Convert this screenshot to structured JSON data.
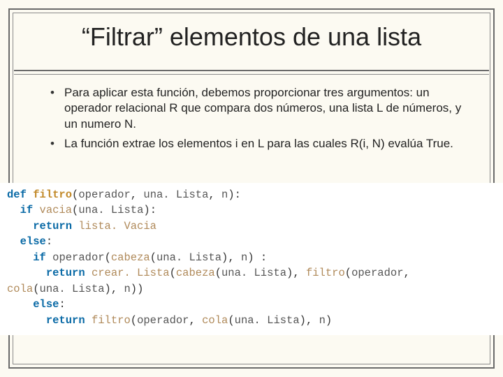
{
  "title": "“Filtrar” elementos de una lista",
  "bullets": [
    "Para aplicar esta función, debemos proporcionar tres argumentos: un operador relacional R que compara dos números, una lista L de números, y un numero N.",
    " La función extrae los elementos i en L para las cuales R(i, N) evalúa True."
  ],
  "code": {
    "kw_def": "def",
    "fn_name": "filtro",
    "arg_operador": "operador",
    "arg_lista": "una. Lista",
    "arg_n": "n",
    "kw_if": "if",
    "kw_else": "else",
    "kw_return": "return",
    "fn_vacia": "vacia",
    "id_listaVacia": "lista. Vacia",
    "fn_cabeza": "cabeza",
    "fn_crearLista": "crear. Lista",
    "fn_cola": "cola",
    "punct_open": "(",
    "punct_close": ")",
    "punct_comma": ",",
    "punct_colon": ":"
  }
}
